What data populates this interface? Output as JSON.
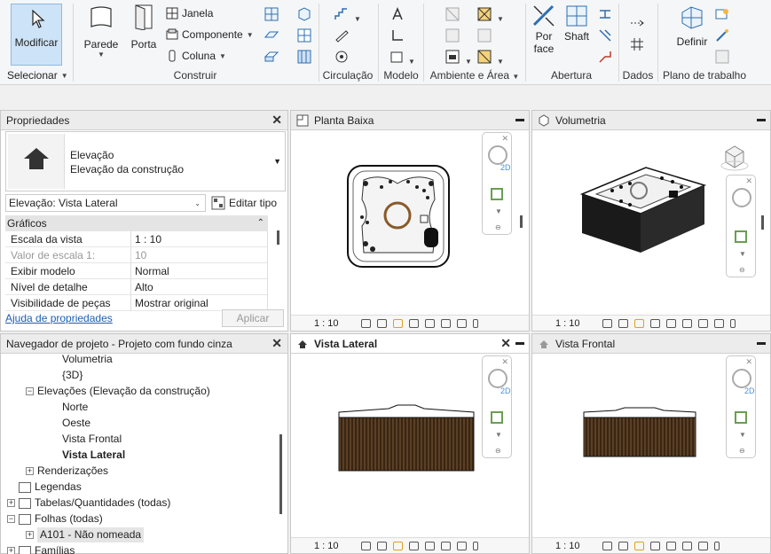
{
  "ribbon": {
    "selecionar": {
      "modificar": "Modificar",
      "label": "Selecionar"
    },
    "construir": {
      "parede": "Parede",
      "porta": "Porta",
      "janela": "Janela",
      "componente": "Componente",
      "coluna": "Coluna",
      "label": "Construir"
    },
    "circulacao": {
      "label": "Circulação"
    },
    "modelo": {
      "label": "Modelo"
    },
    "ambiente": {
      "label": "Ambiente e Área"
    },
    "abertura": {
      "por_face_1": "Por",
      "por_face_2": "face",
      "shaft": "Shaft",
      "label": "Abertura"
    },
    "dados": {
      "label": "Dados"
    },
    "plano": {
      "definir": "Definir",
      "label": "Plano de trabalho"
    }
  },
  "properties": {
    "title": "Propriedades",
    "type_line1": "Elevação",
    "type_line2": "Elevação da construção",
    "instance_selector": "Elevação: Vista Lateral",
    "edit_type": "Editar tipo",
    "group": "Gráficos",
    "rows": [
      {
        "name": "Escala da vista",
        "value": "1 : 10",
        "disabled": false
      },
      {
        "name": "Valor de escala    1:",
        "value": "10",
        "disabled": true
      },
      {
        "name": "Exibir modelo",
        "value": "Normal",
        "disabled": false
      },
      {
        "name": "Nível de detalhe",
        "value": "Alto",
        "disabled": false
      },
      {
        "name": "Visibilidade de peças",
        "value": "Mostrar original",
        "disabled": false
      }
    ],
    "help": "Ajuda de propriedades",
    "apply": "Aplicar"
  },
  "browser": {
    "title": "Navegador de projeto - Projeto com fundo cinza",
    "nodes": {
      "volumetria": "Volumetria",
      "threed": "{3D}",
      "elevacoes": "Elevações (Elevação da construção)",
      "norte": "Norte",
      "oeste": "Oeste",
      "vista_frontal": "Vista Frontal",
      "vista_lateral": "Vista Lateral",
      "renderizacoes": "Renderizações",
      "legendas": "Legendas",
      "tabelas": "Tabelas/Quantidades (todas)",
      "folhas": "Folhas (todas)",
      "a101": "A101 - Não nomeada",
      "familias": "Famílias"
    }
  },
  "views": {
    "planta": {
      "title": "Planta Baixa",
      "scale": "1 : 10"
    },
    "volumetria": {
      "title": "Volumetria",
      "scale": "1 : 10"
    },
    "lateral": {
      "title": "Vista Lateral",
      "scale": "1 : 10"
    },
    "frontal": {
      "title": "Vista Frontal",
      "scale": "1 : 10"
    }
  },
  "navbar_2d": "2D",
  "colors": {
    "accent": "#cde3f7",
    "link": "#1a5fb4",
    "wood": "#5a3a20"
  }
}
